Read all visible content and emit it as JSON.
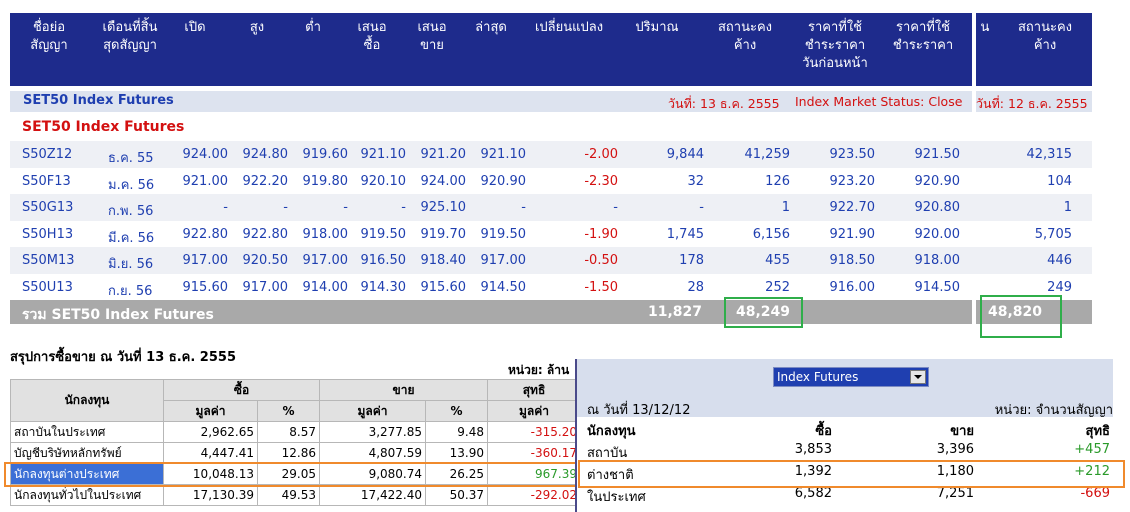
{
  "header": {
    "cols": [
      {
        "l1": "ชื่อย่อ",
        "l2": "สัญญา"
      },
      {
        "l1": "เดือนที่สิ้น",
        "l2": "สุดสัญญา"
      },
      {
        "l1": "เปิด",
        "l2": ""
      },
      {
        "l1": "สูง",
        "l2": ""
      },
      {
        "l1": "ต่ำ",
        "l2": ""
      },
      {
        "l1": "เสนอ",
        "l2": "ซื้อ"
      },
      {
        "l1": "เสนอ",
        "l2": "ขาย"
      },
      {
        "l1": "ล่าสุด",
        "l2": ""
      },
      {
        "l1": "เปลี่ยนแปลง",
        "l2": ""
      },
      {
        "l1": "ปริมาณ",
        "l2": ""
      },
      {
        "l1": "สถานะคง",
        "l2": "ค้าง"
      },
      {
        "l1": "ราคาที่ใช้",
        "l2": "ชำระราคา",
        "l3": "วันก่อนหน้า"
      },
      {
        "l1": "ราคาที่ใช้",
        "l2": "ชำระราคา"
      }
    ],
    "right_cut": "น",
    "right_col": {
      "l1": "สถานะคง",
      "l2": "ค้าง"
    }
  },
  "section": {
    "name": "SET50 Index Futures",
    "date": "วันที่: 13 ธ.ค. 2555",
    "status": "Index Market Status: Close",
    "right_date": "วันที่: 12 ธ.ค. 2555",
    "subtitle": "SET50 Index Futures"
  },
  "rows": [
    {
      "sym": "S50Z12",
      "month": "ธ.ค. 55",
      "open": "924.00",
      "high": "924.80",
      "low": "919.60",
      "bid": "921.10",
      "offer": "921.20",
      "last": "921.10",
      "chg": "-2.00",
      "vol": "9,844",
      "oi": "41,259",
      "prev": "923.50",
      "settle": "921.50",
      "oi_prev": "42,315"
    },
    {
      "sym": "S50F13",
      "month": "ม.ค. 56",
      "open": "921.00",
      "high": "922.20",
      "low": "919.80",
      "bid": "920.10",
      "offer": "924.00",
      "last": "920.90",
      "chg": "-2.30",
      "vol": "32",
      "oi": "126",
      "prev": "923.20",
      "settle": "920.90",
      "oi_prev": "104"
    },
    {
      "sym": "S50G13",
      "month": "ก.พ. 56",
      "open": "-",
      "high": "-",
      "low": "-",
      "bid": "-",
      "offer": "925.10",
      "last": "-",
      "chg": "-",
      "vol": "-",
      "oi": "1",
      "prev": "922.70",
      "settle": "920.80",
      "oi_prev": "1"
    },
    {
      "sym": "S50H13",
      "month": "มี.ค. 56",
      "open": "922.80",
      "high": "922.80",
      "low": "918.00",
      "bid": "919.50",
      "offer": "919.70",
      "last": "919.50",
      "chg": "-1.90",
      "vol": "1,745",
      "oi": "6,156",
      "prev": "921.90",
      "settle": "920.00",
      "oi_prev": "5,705"
    },
    {
      "sym": "S50M13",
      "month": "มิ.ย. 56",
      "open": "917.00",
      "high": "920.50",
      "low": "917.00",
      "bid": "916.50",
      "offer": "918.40",
      "last": "917.00",
      "chg": "-0.50",
      "vol": "178",
      "oi": "455",
      "prev": "918.50",
      "settle": "918.00",
      "oi_prev": "446"
    },
    {
      "sym": "S50U13",
      "month": "ก.ย. 56",
      "open": "915.60",
      "high": "917.00",
      "low": "914.00",
      "bid": "914.30",
      "offer": "915.60",
      "last": "914.50",
      "chg": "-1.50",
      "vol": "28",
      "oi": "252",
      "prev": "916.00",
      "settle": "914.50",
      "oi_prev": "249"
    }
  ],
  "total": {
    "label": "รวม SET50 Index Futures",
    "vol": "11,827",
    "oi": "48,249",
    "oi_prev": "48,820"
  },
  "summary": {
    "title": "สรุปการซื้อขาย ณ วันที่ 13 ธ.ค. 2555",
    "unit": "หน่วย: ล้าน",
    "h_investor": "นักลงทุน",
    "h_buy": "ซื้อ",
    "h_sell": "ขาย",
    "h_net": "สุทธิ",
    "h_value": "มูลค่า",
    "h_pct": "%",
    "rows": [
      {
        "name": "สถาบันในประเทศ",
        "buy": "2,962.65",
        "bpct": "8.57",
        "sell": "3,277.85",
        "spct": "9.48",
        "net": "-315.20",
        "neg": true
      },
      {
        "name": "บัญชีบริษัทหลักทรัพย์",
        "buy": "4,447.41",
        "bpct": "12.86",
        "sell": "4,807.59",
        "spct": "13.90",
        "net": "-360.17",
        "neg": true
      },
      {
        "name": "นักลงทุนต่างประเทศ",
        "buy": "10,048.13",
        "bpct": "29.05",
        "sell": "9,080.74",
        "spct": "26.25",
        "net": "967.39",
        "neg": false
      },
      {
        "name": "นักลงทุนทั่วไปในประเทศ",
        "buy": "17,130.39",
        "bpct": "49.53",
        "sell": "17,422.40",
        "spct": "50.37",
        "net": "-292.02",
        "neg": true
      }
    ]
  },
  "panel": {
    "select": "Index Futures",
    "date": "ณ วันที่ 13/12/12",
    "unit": "หน่วย: จำนวนสัญญา",
    "h_investor": "นักลงทุน",
    "h_buy": "ซื้อ",
    "h_sell": "ขาย",
    "h_net": "สุทธิ",
    "rows": [
      {
        "name": "สถาบัน",
        "buy": "3,853",
        "sell": "3,396",
        "net": "+457"
      },
      {
        "name": "ต่างชาติ",
        "buy": "1,392",
        "sell": "1,180",
        "net": "+212"
      },
      {
        "name": "ในประเทศ",
        "buy": "6,582",
        "sell": "7,251",
        "net": "-669"
      }
    ]
  },
  "colors": {
    "header": "#1e2b8c",
    "link": "#1f3fb0",
    "neg": "#d31010",
    "pos": "#2a9a2a",
    "highlight_green": "#2fae4a",
    "highlight_orange": "#f08a2c"
  }
}
